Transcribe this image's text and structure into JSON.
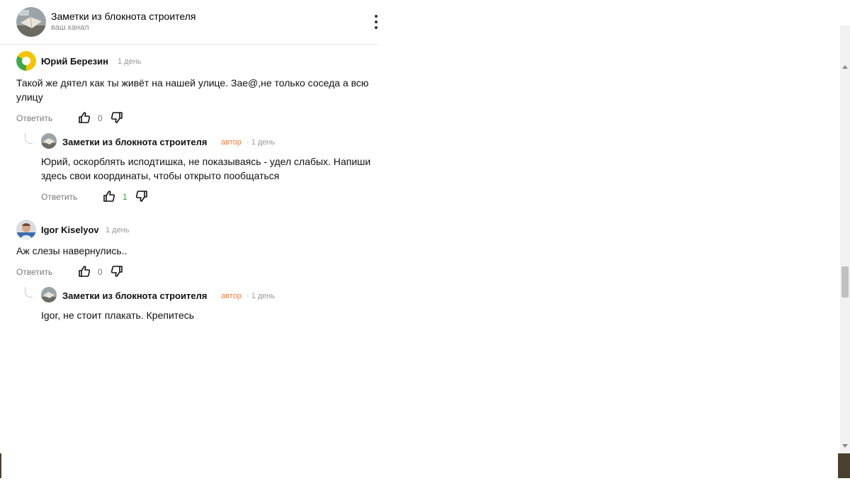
{
  "header": {
    "channel_title": "Заметки из блокнота строителя",
    "channel_subtitle": "ваш канал",
    "menu_icon": "more-vertical-icon"
  },
  "comments": [
    {
      "author": "Юрий Березин",
      "time": "1 день",
      "text": "Такой же дятел как ты живёт на нашей улице. Зае@,не только соседа а всю улицу",
      "reply_label": "Ответить",
      "likes": "0",
      "replies": [
        {
          "author": "Заметки из блокнота строителя",
          "badge": "автор",
          "time": "· 1 день",
          "text": "Юрий, оскорблять исподтишка, не показываясь - удел слабых. Напиши здесь свои координаты, чтобы открыто пообщаться",
          "reply_label": "Ответить",
          "likes": "1"
        }
      ]
    },
    {
      "author": "Igor Kiselyov",
      "time": "1 день",
      "text": "Аж слезы навернулись..",
      "reply_label": "Ответить",
      "likes": "0",
      "replies": [
        {
          "author": "Заметки из блокнота строителя",
          "badge": "автор",
          "time": "· 1 день",
          "text": "Igor, не стоит плакать. Крепитесь"
        }
      ]
    }
  ],
  "colors": {
    "author_badge": "#f07d3b",
    "positive_likes": "#2bab3a",
    "muted_text": "#777777"
  }
}
